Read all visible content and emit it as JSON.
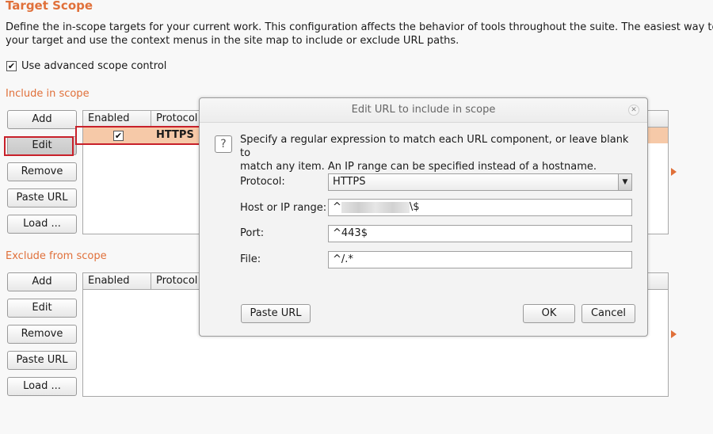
{
  "page": {
    "title": "Target Scope",
    "description_line1": "Define the in-scope targets for your current work. This configuration affects the behavior of tools throughout the suite. The easiest way to cor",
    "description_line2": "your target and use the context menus in the site map to include or exclude URL paths.",
    "advanced_scope_label": "Use advanced scope control",
    "advanced_scope_checked": true
  },
  "include": {
    "heading": "Include in scope",
    "buttons": [
      "Add",
      "Edit",
      "Remove",
      "Paste URL",
      "Load ..."
    ],
    "columns": [
      "Enabled",
      "Protocol"
    ],
    "rows": [
      {
        "enabled": "✔",
        "protocol": "HTTPS"
      }
    ]
  },
  "exclude": {
    "heading": "Exclude from scope",
    "buttons": [
      "Add",
      "Edit",
      "Remove",
      "Paste URL",
      "Load ..."
    ],
    "columns": [
      "Enabled",
      "Protocol"
    ]
  },
  "dialog": {
    "title": "Edit URL to include in scope",
    "help_icon": "?",
    "instructions_line1": "Specify a regular expression to match each URL component, or leave blank to",
    "instructions_line2": "match any item. An IP range can be specified instead of a hostname.",
    "protocol_label": "Protocol:",
    "protocol_value": "HTTPS",
    "host_label": "Host or IP range:",
    "host_prefix": "^",
    "host_suffix": "\\$",
    "port_label": "Port:",
    "port_value": "^443$",
    "file_label": "File:",
    "file_value": "^/.*",
    "paste_url": "Paste URL",
    "ok": "OK",
    "cancel": "Cancel"
  },
  "colors": {
    "accent": "#e0703a",
    "highlight_box": "#c8202a",
    "selected_row": "#f6c9a8"
  }
}
